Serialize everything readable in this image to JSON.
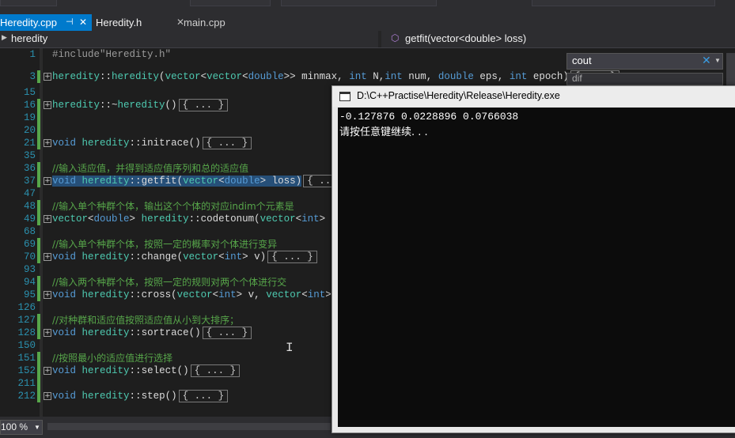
{
  "tabs": [
    {
      "label": "Heredity.cpp",
      "active": true,
      "pin": "⊣",
      "close": "✕"
    },
    {
      "label": "Heredity.h",
      "active": false,
      "close": "✕"
    },
    {
      "label": "main.cpp",
      "active": false
    }
  ],
  "nav": {
    "scope": "heredity",
    "member": "getfit(vector<double> loss)"
  },
  "search": {
    "value": "cout",
    "second_value": "dif"
  },
  "code_lines": [
    {
      "num": "1",
      "text": "#include\"Heredity.h\""
    },
    {
      "num": "3",
      "text": "heredity::heredity(vector<vector<double>> minmax, int N,int num, double eps, int epoch)",
      "collapsed": "{ ... }"
    },
    {
      "num": "15",
      "text": ""
    },
    {
      "num": "16",
      "text": "heredity::~heredity()",
      "collapsed": "{ ... }"
    },
    {
      "num": "19",
      "text": ""
    },
    {
      "num": "20",
      "text": ""
    },
    {
      "num": "21",
      "text": "void heredity::initrace()",
      "collapsed": "{ ... }"
    },
    {
      "num": "35",
      "text": ""
    },
    {
      "num": "36",
      "text": "//输入适应值，并得到适应值序列和总的适应值"
    },
    {
      "num": "37",
      "text": "void heredity::getfit(vector<double> loss)",
      "collapsed": "{ ... }"
    },
    {
      "num": "47",
      "text": ""
    },
    {
      "num": "48",
      "text": "//输入单个种群个体，输出这个个体的对应indim个元素是"
    },
    {
      "num": "49",
      "text": "vector<double> heredity::codetonum(vector<int> v)",
      "collapsed": "{"
    },
    {
      "num": "68",
      "text": ""
    },
    {
      "num": "69",
      "text": "//输入单个种群个体，按照一定的概率对个体进行变异"
    },
    {
      "num": "70",
      "text": "void heredity::change(vector<int> v)",
      "collapsed": "{ ... }"
    },
    {
      "num": "93",
      "text": ""
    },
    {
      "num": "94",
      "text": "//输入两个种群个体，按照一定的规则对两个个体进行交"
    },
    {
      "num": "95",
      "text": "void heredity::cross(vector<int> v, vector<int> m)",
      "collapsed": "{"
    },
    {
      "num": "126",
      "text": ""
    },
    {
      "num": "127",
      "text": "//对种群和适应值按照适应值从小到大排序；"
    },
    {
      "num": "128",
      "text": "void heredity::sortrace()",
      "collapsed": "{ ... }"
    },
    {
      "num": "150",
      "text": ""
    },
    {
      "num": "151",
      "text": "//按照最小的适应值进行选择"
    },
    {
      "num": "152",
      "text": "void heredity::select()",
      "collapsed": "{ ... }"
    },
    {
      "num": "211",
      "text": ""
    },
    {
      "num": "212",
      "text": "void heredity::step()",
      "collapsed": "{ ... }"
    }
  ],
  "console": {
    "title": "D:\\C++Practise\\Heredity\\Release\\Heredity.exe",
    "output_line1": "-0.127876 0.0228896 0.0766038",
    "output_line2": "请按任意键继续. . ."
  },
  "status": {
    "zoom": "100 %"
  },
  "colors": {
    "accent": "#007acc",
    "comment": "#57a64a",
    "keyword": "#569cd6",
    "type": "#4ec9b0",
    "line_number": "#2b91af",
    "editor_bg": "#1e1e1e",
    "console_bg": "#0c0c0c"
  },
  "icons": {
    "pin": "pin-icon",
    "close": "close-icon",
    "member": "method-icon",
    "fold": "fold-toggle-icon",
    "console": "console-window-icon"
  }
}
